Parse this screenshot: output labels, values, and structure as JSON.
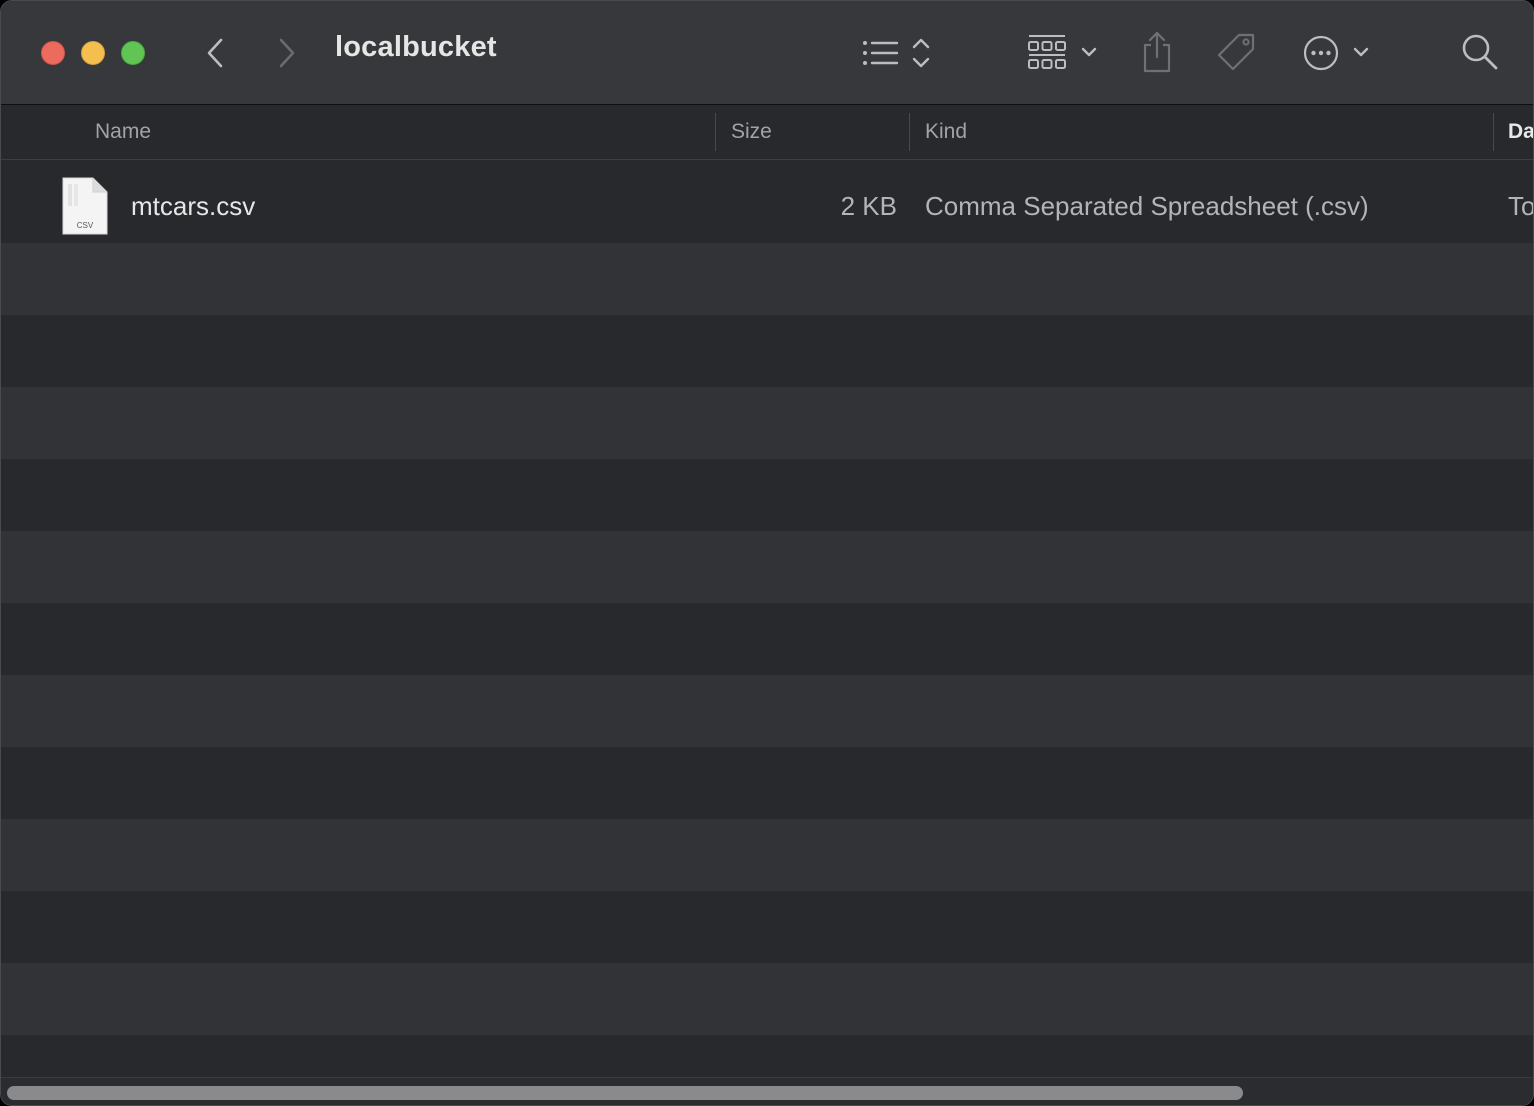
{
  "window": {
    "title": "localbucket"
  },
  "toolbar": {
    "back_icon": "chevron-left-icon",
    "forward_icon": "chevron-right-icon",
    "view_options_icon": "list-view-icon",
    "group_icon": "grid-group-icon",
    "share_icon": "share-icon",
    "tag_icon": "tag-icon",
    "more_icon": "ellipsis-circle-icon",
    "search_icon": "search-icon"
  },
  "columns": {
    "name": "Name",
    "size": "Size",
    "kind": "Kind",
    "date": "Da"
  },
  "files": [
    {
      "icon_label": "CSV",
      "name": "mtcars.csv",
      "size": "2 KB",
      "kind": "Comma Separated Spreadsheet (.csv)",
      "date": "To"
    }
  ],
  "colors": {
    "close": "#ec6a5e",
    "minimize": "#f4bf4f",
    "maximize": "#61c554"
  }
}
